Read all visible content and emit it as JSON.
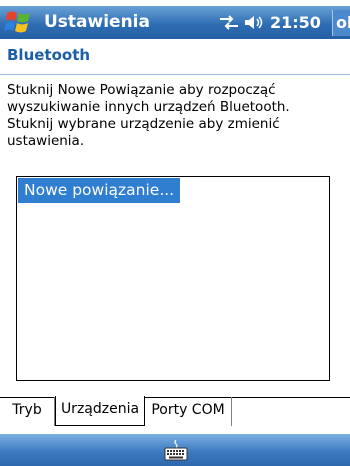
{
  "titlebar": {
    "app_title": "Ustawienia",
    "clock": "21:50",
    "ok_label": "ok",
    "start_icon": "windows-flag-icon",
    "connectivity_icon": "connectivity-icon",
    "volume_icon": "volume-icon"
  },
  "page": {
    "title": "Bluetooth",
    "instructions": "Stuknij Nowe Powiązanie aby rozpocząć wyszukiwanie innych urządzeń Bluetooth. Stuknij wybrane urządzenie aby zmienić ustawienia."
  },
  "device_list": {
    "items": [
      "Nowe powiązanie..."
    ]
  },
  "tabs": [
    {
      "label": "Tryb",
      "selected": false
    },
    {
      "label": "Urządzenia",
      "selected": true
    },
    {
      "label": "Porty COM",
      "selected": false
    }
  ],
  "menubar": {
    "input_icon": "keyboard-icon"
  },
  "colors": {
    "titlebar": "#2f6eb4",
    "accent_text": "#1a5fa8",
    "selection": "#2f7ed0"
  }
}
